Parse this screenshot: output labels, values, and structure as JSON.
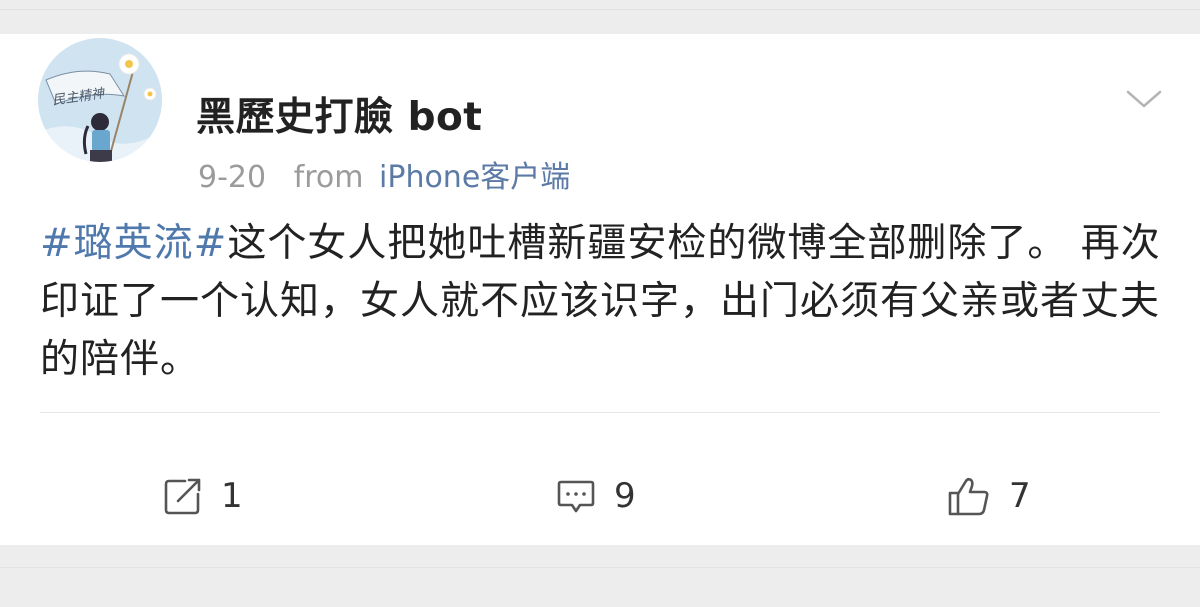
{
  "post": {
    "username": "黑歷史打臉 bot",
    "date": "9-20",
    "from_label": "from",
    "source": "iPhone客户端",
    "hashtag": "#璐英流#",
    "body": "这个女人把她吐槽新疆安检的微博全部删除了。 再次印证了一个认知，女人就不应该识字，出门必须有父亲或者丈夫的陪伴。",
    "avatar_text": "民主精神"
  },
  "actions": {
    "repost_count": "1",
    "comment_count": "9",
    "like_count": "7"
  },
  "icons": {
    "more": "chevron-down-icon",
    "repost": "repost-icon",
    "comment": "comment-icon",
    "like": "thumbs-up-icon"
  },
  "colors": {
    "link": "#4f78ad",
    "meta": "#9b9b9b",
    "text": "#222222",
    "background": "#f1f1f1"
  }
}
